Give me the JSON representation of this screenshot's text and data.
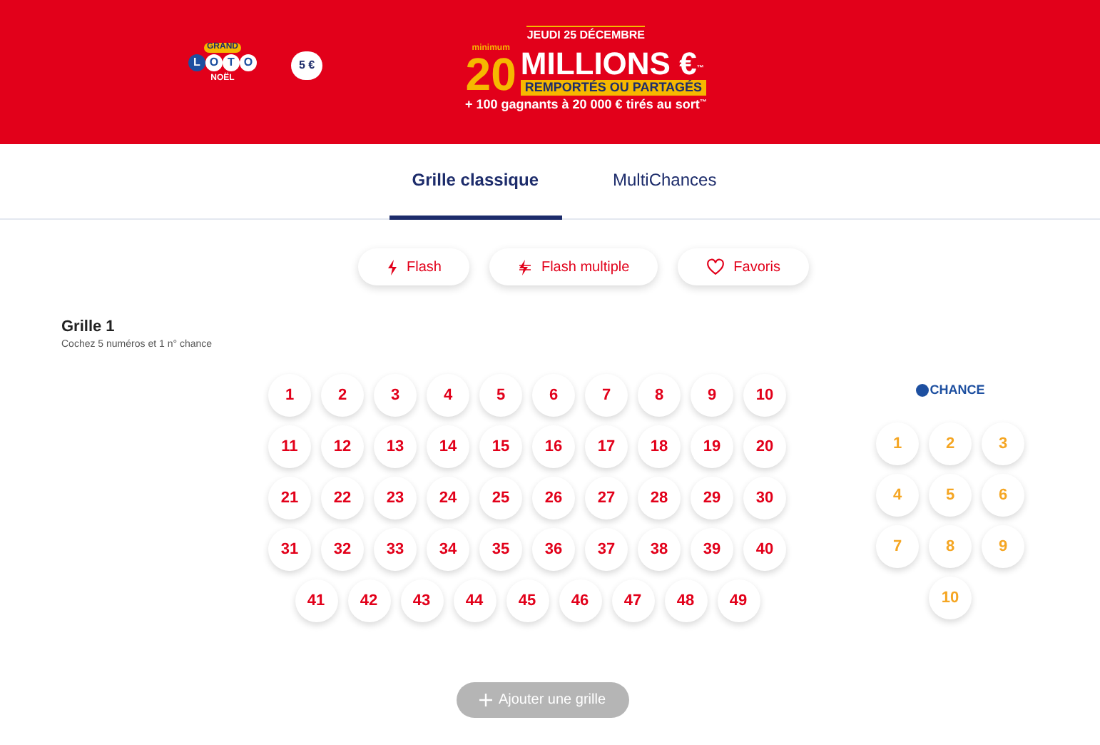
{
  "banner": {
    "logo": {
      "small": "GRAND",
      "letters": [
        "L",
        "O",
        "T",
        "O"
      ],
      "caption": "NOËL"
    },
    "price": "5 €",
    "date": "JEUDI 25 DÉCEMBRE",
    "minimum": "minimum",
    "amount": "20",
    "headline": "MILLIONS €",
    "trademark": "™",
    "tagline": "REMPORTÉS OU PARTAGÉS",
    "subline": "+ 100 gagnants à 20 000 € tirés au sort",
    "subline_mark": "™"
  },
  "tabs": [
    {
      "label": "Grille classique",
      "selected": true
    },
    {
      "label": "MultiChances",
      "selected": false
    }
  ],
  "actions": [
    {
      "label": "Flash",
      "kind": "flash"
    },
    {
      "label": "Flash multiple",
      "kind": "multi"
    },
    {
      "label": "Favoris",
      "kind": "favorite"
    }
  ],
  "grid": {
    "title": "Grille 1",
    "instructions": "Cochez 5 numéros et 1 n° chance",
    "numbers": [
      [
        "1",
        "2",
        "3",
        "4",
        "5",
        "6",
        "7",
        "8",
        "9",
        "10"
      ],
      [
        "11",
        "12",
        "13",
        "14",
        "15",
        "16",
        "17",
        "18",
        "19",
        "20"
      ],
      [
        "21",
        "22",
        "23",
        "24",
        "25",
        "26",
        "27",
        "28",
        "29",
        "30"
      ],
      [
        "31",
        "32",
        "33",
        "34",
        "35",
        "36",
        "37",
        "38",
        "39",
        "40"
      ],
      [
        "41",
        "42",
        "43",
        "44",
        "45",
        "46",
        "47",
        "48",
        "49"
      ]
    ],
    "chance_label": "CHANCE",
    "chance_numbers": [
      [
        "1",
        "2",
        "3"
      ],
      [
        "4",
        "5",
        "6"
      ],
      [
        "7",
        "8",
        "9"
      ],
      [
        "10"
      ]
    ]
  },
  "add_button": {
    "label": "Ajouter une grille",
    "disabled": true
  }
}
